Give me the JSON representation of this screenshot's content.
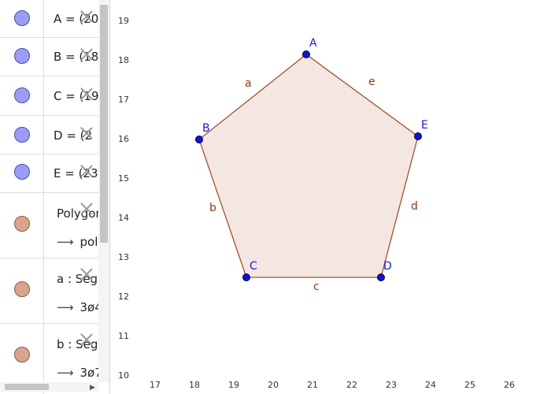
{
  "algebra": {
    "points": [
      {
        "text": "A = (20"
      },
      {
        "text": "B = (18"
      },
      {
        "text": "C = (19"
      },
      {
        "text": "D = (2"
      },
      {
        "text": "E = (23"
      }
    ],
    "objects": [
      {
        "text": "Polygon",
        "sub": "poly"
      },
      {
        "text": "a : Segm",
        "sub": "3ø4"
      },
      {
        "text": "b : Segm",
        "sub": "3ø7"
      }
    ],
    "arrow": "⟶"
  },
  "graphics": {
    "x_ticks": [
      "17",
      "18",
      "19",
      "20",
      "21",
      "22",
      "23",
      "24",
      "25",
      "26"
    ],
    "y_ticks": [
      "19",
      "18",
      "17",
      "16",
      "15",
      "14",
      "13",
      "12",
      "11",
      "10"
    ],
    "points": [
      {
        "label": "A"
      },
      {
        "label": "B"
      },
      {
        "label": "C"
      },
      {
        "label": "D"
      },
      {
        "label": "E"
      }
    ],
    "segments": [
      {
        "label": "a"
      },
      {
        "label": "b"
      },
      {
        "label": "c"
      },
      {
        "label": "d"
      },
      {
        "label": "e"
      }
    ],
    "colors": {
      "polygon_fill": "#f4e7e1",
      "polygon_stroke": "#a0522d",
      "point": "#1414cc",
      "point_label": "#1a1ad6",
      "segment_label": "#8b3a0e"
    }
  }
}
